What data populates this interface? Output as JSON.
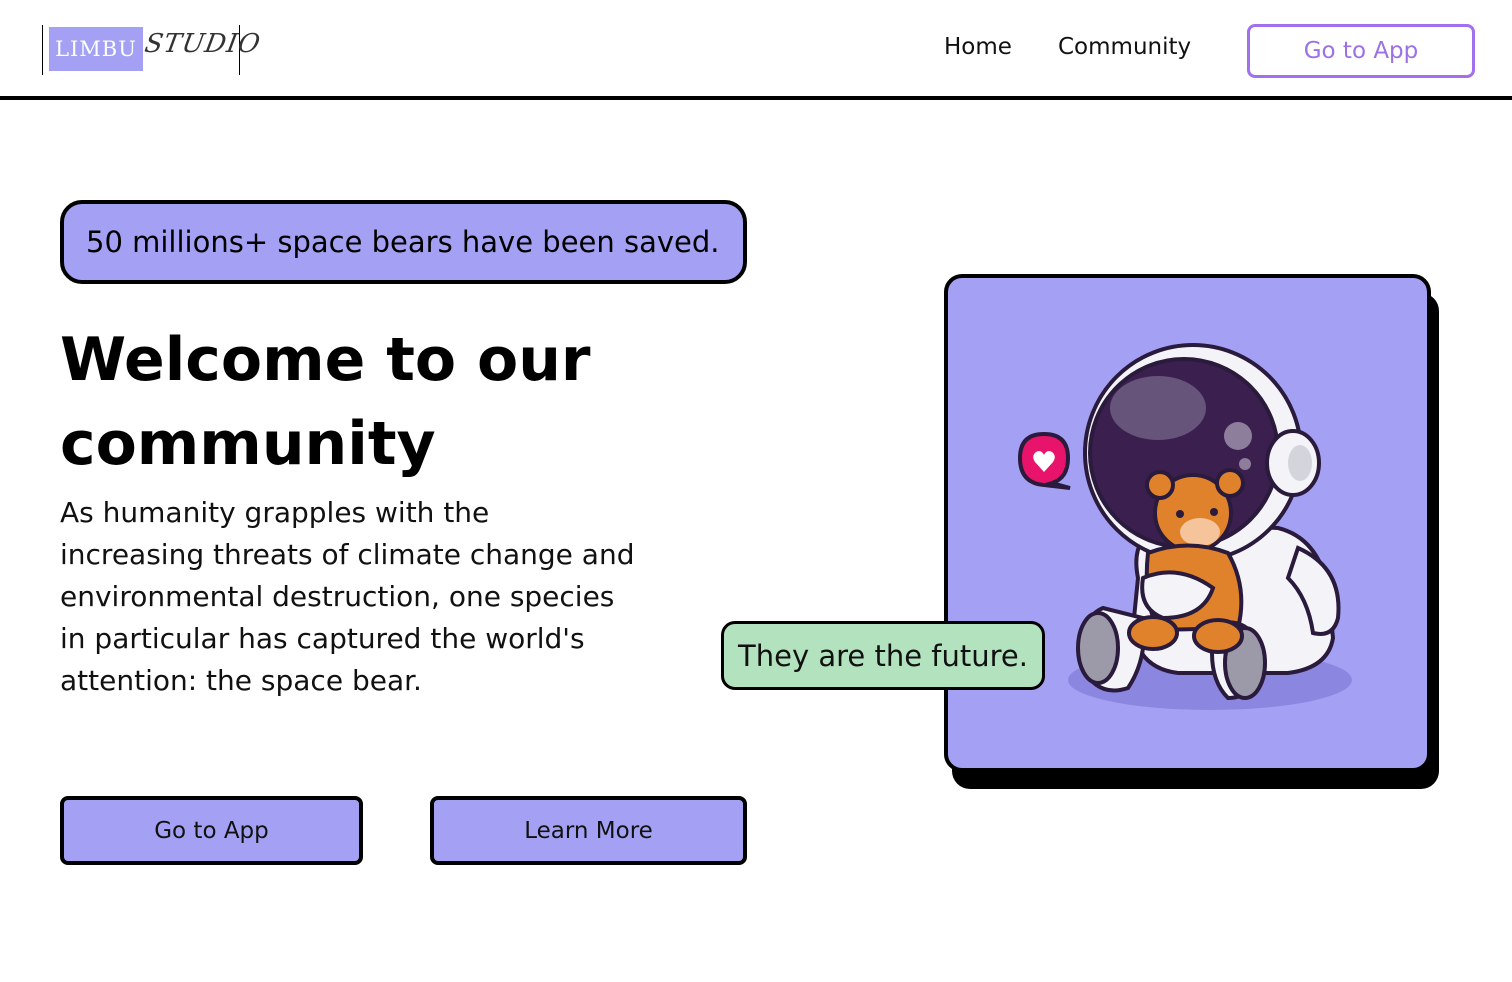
{
  "header": {
    "logo": {
      "part1": "LIMBU",
      "part2": "STUDIO"
    },
    "nav": {
      "home": "Home",
      "community": "Community",
      "go_to_app": "Go to App"
    }
  },
  "hero": {
    "pill_text": "50 millions+ space bears have been saved.",
    "title": "Welcome to our community",
    "paragraph": "As humanity grapples with the increasing threats of climate change and environmental destruction, one species in particular has captured the world's attention: the space bear.",
    "buttons": {
      "go_to_app": "Go to App",
      "learn_more": "Learn More"
    }
  },
  "illustration": {
    "bubble_text": "They are the future.",
    "alt": "astronaut-holding-teddy-bear"
  },
  "colors": {
    "accent_purple": "#a4a1f4",
    "nav_button_purple": "#9a72e6",
    "bubble_green": "#b3e3be",
    "heart_pink": "#e8146b"
  }
}
